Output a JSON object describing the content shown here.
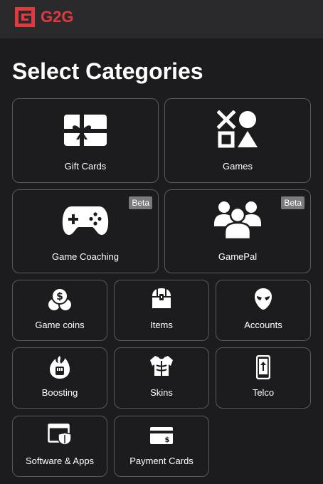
{
  "header": {
    "logo_text": "G2G",
    "brand_color": "#e03a3e"
  },
  "page": {
    "title": "Select Categories"
  },
  "categories": [
    {
      "label": "Gift Cards",
      "icon": "gift-card-icon",
      "badge": ""
    },
    {
      "label": "Games",
      "icon": "games-shapes-icon",
      "badge": ""
    },
    {
      "label": "Game Coaching",
      "icon": "gamepad-icon",
      "badge": "Beta"
    },
    {
      "label": "GamePal",
      "icon": "group-users-icon",
      "badge": "Beta"
    },
    {
      "label": "Game coins",
      "icon": "coins-icon",
      "badge": ""
    },
    {
      "label": "Items",
      "icon": "treasure-chest-icon",
      "badge": ""
    },
    {
      "label": "Accounts",
      "icon": "alien-head-icon",
      "badge": ""
    },
    {
      "label": "Boosting",
      "icon": "flame-fist-icon",
      "badge": ""
    },
    {
      "label": "Skins",
      "icon": "armor-icon",
      "badge": ""
    },
    {
      "label": "Telco",
      "icon": "mobile-topup-icon",
      "badge": ""
    },
    {
      "label": "Software & Apps",
      "icon": "software-window-shield-icon",
      "badge": ""
    },
    {
      "label": "Payment Cards",
      "icon": "payment-card-icon",
      "badge": ""
    }
  ]
}
